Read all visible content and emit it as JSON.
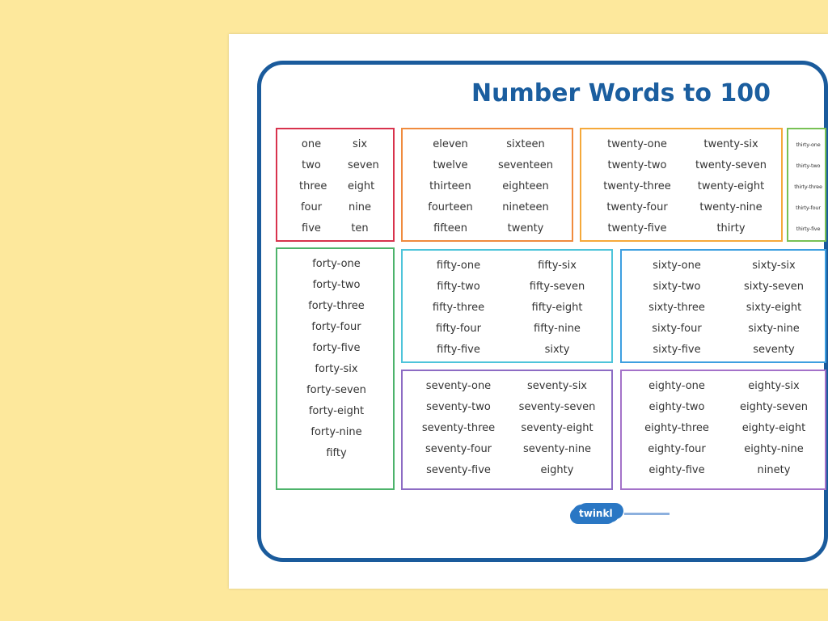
{
  "title": "Number Words to 100",
  "logo": {
    "text": "twinkl"
  },
  "boxes": [
    {
      "id": "1-10",
      "color": "#d8334d",
      "columns": [
        [
          "one",
          "two",
          "three",
          "four",
          "five"
        ],
        [
          "six",
          "seven",
          "eight",
          "nine",
          "ten"
        ]
      ]
    },
    {
      "id": "11-20",
      "color": "#f08b3e",
      "columns": [
        [
          "eleven",
          "twelve",
          "thirteen",
          "fourteen",
          "fifteen"
        ],
        [
          "sixteen",
          "seventeen",
          "eighteen",
          "nineteen",
          "twenty"
        ]
      ]
    },
    {
      "id": "21-30",
      "color": "#f5a93a",
      "columns": [
        [
          "twenty-one",
          "twenty-two",
          "twenty-three",
          "twenty-four",
          "twenty-five"
        ],
        [
          "twenty-six",
          "twenty-seven",
          "twenty-eight",
          "twenty-nine",
          "thirty"
        ]
      ]
    },
    {
      "id": "31-40",
      "color": "#78c155",
      "columns": [
        [
          "thirty-one",
          "thirty-two",
          "thirty-three",
          "thirty-four",
          "thirty-five"
        ]
      ]
    },
    {
      "id": "41-50",
      "color": "#4db36b",
      "columns": [
        [
          "forty-one",
          "forty-two",
          "forty-three",
          "forty-four",
          "forty-five",
          "forty-six",
          "forty-seven",
          "forty-eight",
          "forty-nine",
          "fifty"
        ]
      ]
    },
    {
      "id": "51-60",
      "color": "#4ec4da",
      "columns": [
        [
          "fifty-one",
          "fifty-two",
          "fifty-three",
          "fifty-four",
          "fifty-five"
        ],
        [
          "fifty-six",
          "fifty-seven",
          "fifty-eight",
          "fifty-nine",
          "sixty"
        ]
      ]
    },
    {
      "id": "61-70",
      "color": "#3d9fe0",
      "columns": [
        [
          "sixty-one",
          "sixty-two",
          "sixty-three",
          "sixty-four",
          "sixty-five"
        ],
        [
          "sixty-six",
          "sixty-seven",
          "sixty-eight",
          "sixty-nine",
          "seventy"
        ]
      ]
    },
    {
      "id": "71-80",
      "color": "#8d6cc4",
      "columns": [
        [
          "seventy-one",
          "seventy-two",
          "seventy-three",
          "seventy-four",
          "seventy-five"
        ],
        [
          "seventy-six",
          "seventy-seven",
          "seventy-eight",
          "seventy-nine",
          "eighty"
        ]
      ]
    },
    {
      "id": "81-90",
      "color": "#a472c9",
      "columns": [
        [
          "eighty-one",
          "eighty-two",
          "eighty-three",
          "eighty-four",
          "eighty-five"
        ],
        [
          "eighty-six",
          "eighty-seven",
          "eighty-eight",
          "eighty-nine",
          "ninety"
        ]
      ]
    }
  ]
}
